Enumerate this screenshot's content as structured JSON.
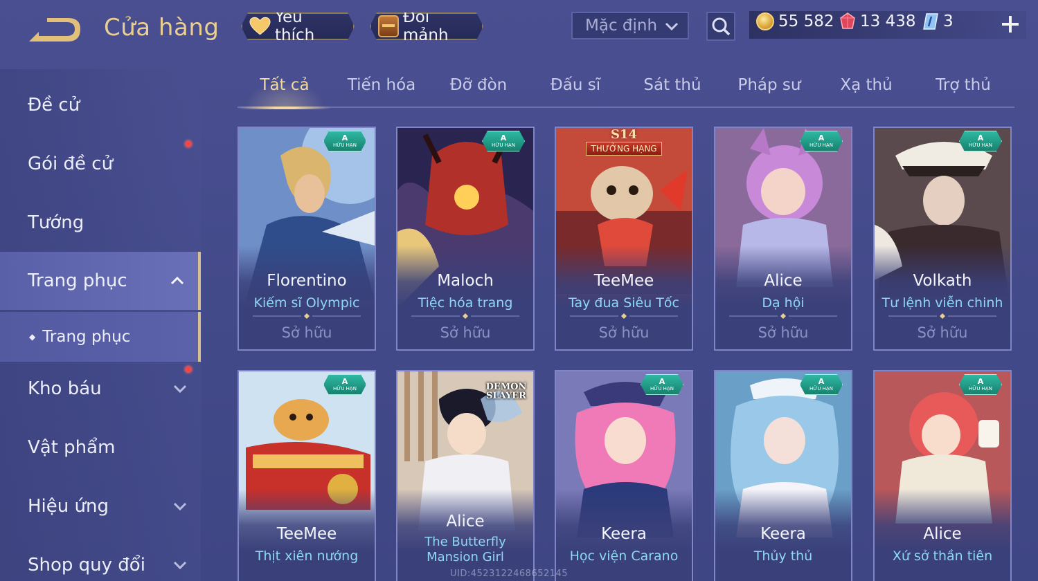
{
  "header": {
    "title": "Cửa hàng",
    "favorites_label": "Yêu thích",
    "exchange_label": "Đổi mảnh",
    "sort_value": "Mặc định"
  },
  "currency": {
    "gold": "55 582",
    "ruby": "13 438",
    "voucher": "3"
  },
  "sidebar": {
    "items": [
      {
        "label": "Đề cử"
      },
      {
        "label": "Gói đề cử"
      },
      {
        "label": "Tướng"
      },
      {
        "label": "Trang phục"
      },
      {
        "label": "Kho báu"
      },
      {
        "label": "Vật phẩm"
      },
      {
        "label": "Hiệu ứng"
      },
      {
        "label": "Shop quy đổi"
      }
    ],
    "sub_items": [
      {
        "label": "Trang phục"
      }
    ]
  },
  "tabs": [
    {
      "label": "Tất cả"
    },
    {
      "label": "Tiến hóa"
    },
    {
      "label": "Đỡ đòn"
    },
    {
      "label": "Đấu sĩ"
    },
    {
      "label": "Sát thủ"
    },
    {
      "label": "Pháp sư"
    },
    {
      "label": "Xạ thủ"
    },
    {
      "label": "Trợ thủ"
    }
  ],
  "badge": {
    "tier": "A",
    "limited": "HỮU HẠN",
    "season": "S14",
    "rank": "THƯỞNG HẠNG",
    "demon_line1": "DEMON",
    "demon_line2": "SLAYER"
  },
  "cards": [
    {
      "hero": "Florentino",
      "skin": "Kiếm sĩ Olympic",
      "status": "Sở hữu"
    },
    {
      "hero": "Maloch",
      "skin": "Tiệc hóa trang",
      "status": "Sở hữu"
    },
    {
      "hero": "TeeMee",
      "skin": "Tay đua Siêu Tốc",
      "status": "Sở hữu"
    },
    {
      "hero": "Alice",
      "skin": "Dạ hội",
      "status": "Sở hữu"
    },
    {
      "hero": "Volkath",
      "skin": "Tư lệnh viễn chinh",
      "status": "Sở hữu"
    },
    {
      "hero": "TeeMee",
      "skin": "Thịt xiên nướng"
    },
    {
      "hero": "Alice",
      "skin": "The Butterfly Mansion Girl"
    },
    {
      "hero": "Keera",
      "skin": "Học viện Carano"
    },
    {
      "hero": "Keera",
      "skin": "Thủy thủ"
    },
    {
      "hero": "Alice",
      "skin": "Xứ sở thần tiên"
    }
  ],
  "footer": {
    "uid": "UID:4523122468652145"
  },
  "colors": {
    "accent_gold": "#e9cf92",
    "skin_name_blue": "#8fd7f2",
    "notification_red": "#e94b4b",
    "limited_badge_teal": "#2fb8a2"
  }
}
